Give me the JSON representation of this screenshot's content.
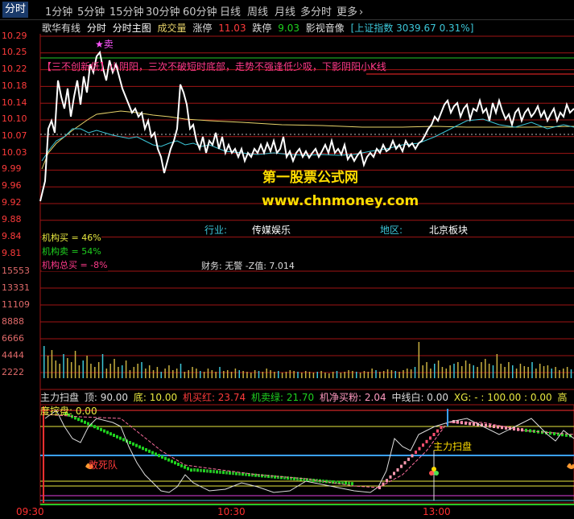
{
  "tabs": [
    {
      "label": "分时",
      "active": true
    },
    {
      "label": "1分钟"
    },
    {
      "label": "5分钟"
    },
    {
      "label": "15分钟"
    },
    {
      "label": "30分钟"
    },
    {
      "label": "60分钟"
    },
    {
      "label": "日线"
    },
    {
      "label": "周线"
    },
    {
      "label": "月线"
    },
    {
      "label": "多分时"
    },
    {
      "label": "更多"
    }
  ],
  "more_chevron": "›",
  "info": {
    "stock_name": "歌华有线",
    "mode1": "分时",
    "mode2": "分时主图",
    "volume_label": "成交量",
    "limit_up_label": "涨停",
    "limit_up_value": "11.03",
    "limit_down_label": "跌停",
    "limit_down_value": "9.03",
    "sector": "影视音像",
    "index_text": "[上证指数 3039.67 0.31%]"
  },
  "price_axis": [
    "10.29",
    "10.25",
    "10.22",
    "10.18",
    "10.14",
    "10.10",
    "10.07",
    "10.03",
    "9.99",
    "9.96",
    "9.92",
    "9.88",
    "9.84",
    "9.81"
  ],
  "volume_axis": [
    "15553",
    "13331",
    "11109",
    "8888",
    "6666",
    "4444",
    "2222"
  ],
  "annotations": {
    "sell_marker": "★卖",
    "red_banner": "【三不创新低】小阴阳，三次不破短时底部，走势不强逢低少吸，下影阴阳小K线",
    "watermark1": "第一股票公式网",
    "watermark2": "www.chnmoney.com",
    "industry_label": "行业:",
    "industry_value": "传媒娱乐",
    "region_label": "地区:",
    "region_value": "北京板块",
    "inst_buy": "机构买 = 46%",
    "inst_sell": "机构卖 = 54%",
    "inst_total": "机构总买 = -8%",
    "finance_text": "财务: 无警  -Z值: 7.014"
  },
  "indicator_bar": {
    "name": "主力扫盘",
    "top_label": "顶: 90.00",
    "bottom_label": "底: 10.00",
    "red_label": "机买红: 23.74",
    "green_label": "机卖绿: 21.70",
    "net_label": "机净买粉: 2.04",
    "mid_label": "中线白: 0.00",
    "xg_label": "XG: - : 100.00 : 0.00",
    "control_label": "高度控盘: 0.00"
  },
  "indicator_annotations": {
    "dead_team": "敢死队",
    "main_sweep": "主力扫盘"
  },
  "time_axis": [
    "09:30",
    "10:30",
    "13:00"
  ],
  "colors": {
    "price_line": "#ffffff",
    "avg_line": "#e8d36a",
    "cyan_line": "#3cc6d8",
    "grid_red": "#a01515",
    "up": "#ff3b3b",
    "down": "#1fd11f",
    "volume_bar": "#c8b040",
    "watermark": "#ffdd00"
  }
}
